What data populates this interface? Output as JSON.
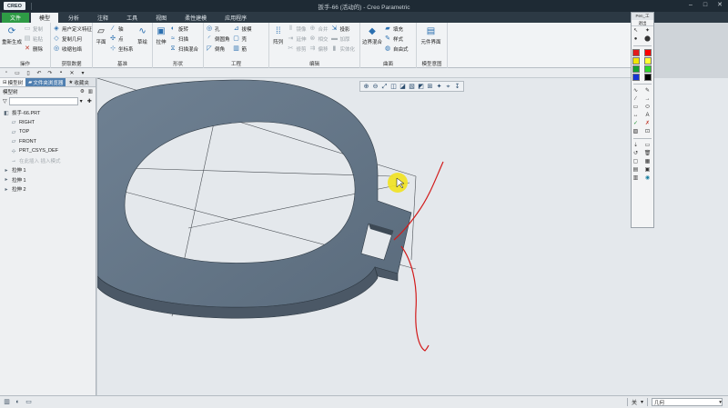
{
  "app": {
    "logo": "CREO",
    "window_title": "扳手-66 (活动的) - Creo Parametric",
    "window_controls": [
      "–",
      "□",
      "✕"
    ]
  },
  "tabs": [
    "文件",
    "模型",
    "分析",
    "注释",
    "工具",
    "视图",
    "柔性建模",
    "应用程序"
  ],
  "ribbon": {
    "groups": [
      {
        "label": "操作",
        "big": [
          {
            "icon": "regenerate-icon",
            "glyph": "⟳",
            "label": "重新生成"
          }
        ],
        "small": [
          [
            "复制",
            "粘贴",
            "删除"
          ]
        ]
      },
      {
        "label": "获取数据",
        "small": [
          [
            "用户定义特征",
            "复制几何",
            "收缩包络"
          ]
        ]
      },
      {
        "label": "基准",
        "big": [
          {
            "icon": "plane-icon",
            "glyph": "▱",
            "label": "平面"
          },
          {
            "icon": "sketch-icon",
            "glyph": "∿",
            "label": "草绘"
          }
        ],
        "small": [
          [
            "轴",
            "点",
            "坐标系"
          ]
        ]
      },
      {
        "label": "形状",
        "big": [
          {
            "icon": "extrude-icon",
            "glyph": "▣",
            "label": "拉伸"
          }
        ],
        "small": [
          [
            "旋转",
            "扫描",
            "扫描混合"
          ]
        ]
      },
      {
        "label": "工程",
        "small": [
          [
            "孔",
            "倒圆角",
            "倒角"
          ],
          [
            "拔模",
            "壳",
            "筋"
          ]
        ]
      },
      {
        "label": "编辑",
        "big": [
          {
            "icon": "array-icon",
            "glyph": "⁞⁞",
            "label": "阵列"
          }
        ],
        "small": [
          [
            "镜像",
            "延伸",
            "修剪"
          ],
          [
            "合并",
            "相交",
            "偏移"
          ],
          [
            "投影",
            "加厚",
            "实体化"
          ]
        ]
      },
      {
        "label": "曲面",
        "big": [
          {
            "icon": "boundary-blend-icon",
            "glyph": "◆",
            "label": "边界混合"
          }
        ],
        "small": [
          [
            "填充",
            "样式",
            "自由式"
          ]
        ]
      },
      {
        "label": "模型意图",
        "big": [
          {
            "icon": "element-interface-icon",
            "glyph": "▤",
            "label": "元件界面"
          }
        ]
      }
    ]
  },
  "qat": [
    "▫",
    "▭",
    "▯",
    "↶",
    "↷",
    "▪",
    "✕",
    "▾"
  ],
  "left_panel": {
    "tabs": [
      "模型树",
      "文件夹浏览器",
      "收藏夹"
    ],
    "toolbar_label": "模型树",
    "tree": [
      {
        "icon": "part-icon",
        "glyph": "◧",
        "label": "扳手-66.PRT",
        "indent": 0,
        "dim": false
      },
      {
        "icon": "datum-plane-icon",
        "glyph": "▱",
        "label": "RIGHT",
        "indent": 1,
        "dim": false
      },
      {
        "icon": "datum-plane-icon",
        "glyph": "▱",
        "label": "TOP",
        "indent": 1,
        "dim": false
      },
      {
        "icon": "datum-plane-icon",
        "glyph": "▱",
        "label": "FRONT",
        "indent": 1,
        "dim": false
      },
      {
        "icon": "csys-icon",
        "glyph": "⊹",
        "label": "PRT_CSYS_DEF",
        "indent": 1,
        "dim": false
      },
      {
        "icon": "insert-here-icon",
        "glyph": "→",
        "label": "在此插入 插入模式",
        "indent": 1,
        "dim": true
      },
      {
        "icon": "extrude-feature-icon",
        "glyph": "▸",
        "label": "拉伸 1",
        "indent": 0,
        "dim": false
      },
      {
        "icon": "extrude-feature-icon",
        "glyph": "▸",
        "label": "拉伸 1",
        "indent": 0,
        "dim": false
      },
      {
        "icon": "extrude-feature-icon",
        "glyph": "▸",
        "label": "拉伸 2",
        "indent": 0,
        "dim": false
      }
    ]
  },
  "view_toolbar": [
    "⊕",
    "⊖",
    "⤢",
    "◫",
    "◪",
    "▧",
    "◩",
    "⊞",
    "✦",
    "⌖",
    "↧"
  ],
  "palette": {
    "title": "Pen_工",
    "button": "退出",
    "colors": [
      "#e21b1b",
      "#ff0000",
      "#f0e600",
      "#ffff33",
      "#14a032",
      "#2bd42b",
      "#1532d6",
      "#000000"
    ],
    "tools": [
      "∿",
      "∕",
      "—",
      "→",
      "▭",
      "⬭",
      "↔",
      "A",
      "✓",
      "✗",
      "▨",
      "⊡",
      "⇣",
      "▭",
      "↺",
      "🗑",
      "▢",
      "▦",
      "▤",
      "▣",
      "▥",
      "⌂"
    ]
  },
  "status": {
    "language": "关",
    "selector": "几何"
  }
}
